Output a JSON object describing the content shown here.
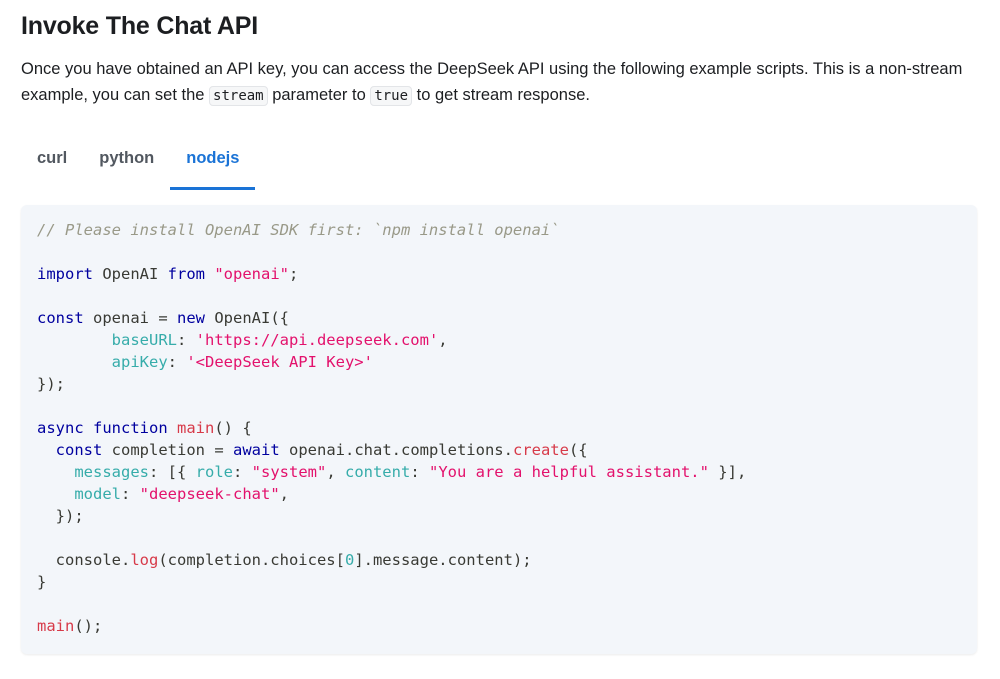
{
  "heading": "Invoke The Chat API",
  "intro": {
    "part1": "Once you have obtained an API key, you can access the DeepSeek API using the following example scripts. This is a non-stream example, you can set the ",
    "code1": "stream",
    "part2": " parameter to ",
    "code2": "true",
    "part3": " to get stream response."
  },
  "tabs": [
    {
      "label": "curl",
      "active": false
    },
    {
      "label": "python",
      "active": false
    },
    {
      "label": "nodejs",
      "active": true
    }
  ],
  "code": {
    "comment": "// Please install OpenAI SDK first: `npm install openai`",
    "kw_import": "import",
    "openai_class": " OpenAI ",
    "kw_from": "from",
    "module_str": "\"openai\"",
    "semicolon": ";",
    "kw_const": "const",
    "openai_var": " openai = ",
    "kw_new": "new",
    "openai_ctor": " OpenAI({",
    "indent8": "        ",
    "prop_baseurl": "baseURL",
    "colon_sp": ": ",
    "baseurl_str": "'https://api.deepseek.com'",
    "comma": ",",
    "prop_apikey": "apiKey",
    "apikey_str": "'<DeepSeek API Key>'",
    "close_ctor": "});",
    "kw_async": "async",
    "sp": " ",
    "kw_function": "function",
    "fn_main": "main",
    "main_sig": "() {",
    "indent2": "  ",
    "completion_decl": " completion = ",
    "kw_await": "await",
    "chat_path": " openai.chat.completions.",
    "fn_create": "create",
    "open_args": "({",
    "indent4": "    ",
    "prop_messages": "messages",
    "msg_open": "[{ ",
    "prop_role": "role",
    "role_str": "\"system\"",
    "comma_sp": ", ",
    "prop_content": "content",
    "content_str": "\"You are a helpful assistant.\"",
    "msg_close": " }],",
    "prop_model": "model",
    "model_str": "\"deepseek-chat\"",
    "close_args": "});",
    "console_obj": "console.",
    "fn_log": "log",
    "log_open": "(completion.choices[",
    "zero": "0",
    "log_close": "].message.content);",
    "close_brace": "}",
    "main_call": "main",
    "main_call_tail": "();"
  }
}
